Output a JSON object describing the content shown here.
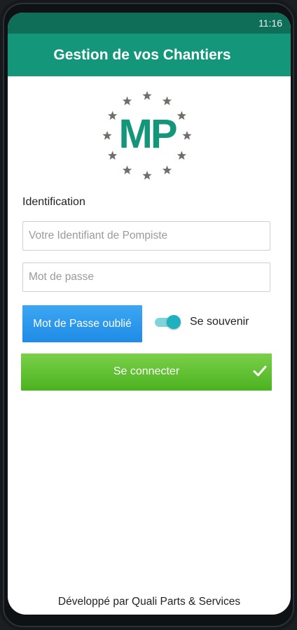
{
  "status_bar": {
    "time": "11:16"
  },
  "app_bar": {
    "title": "Gestion de vos Chantiers"
  },
  "logo": {
    "text": "MP"
  },
  "login": {
    "section_label": "Identification",
    "user_placeholder": "Votre Identifiant de Pompiste",
    "password_placeholder": "Mot de passe",
    "forgot_label": "Mot de Passe oublié",
    "remember_label": "Se souvenir",
    "remember_on": true,
    "connect_label": "Se connecter"
  },
  "footer": {
    "text": "Développé par Quali Parts & Services"
  },
  "colors": {
    "status_bar": "#0f6e57",
    "app_bar": "#14967a",
    "logo_text": "#14967a",
    "logo_stars": "#6f6f6a",
    "forgot_button": "#2f9bef",
    "toggle": "#1fb1bf",
    "connect_button": "#5fc034"
  }
}
